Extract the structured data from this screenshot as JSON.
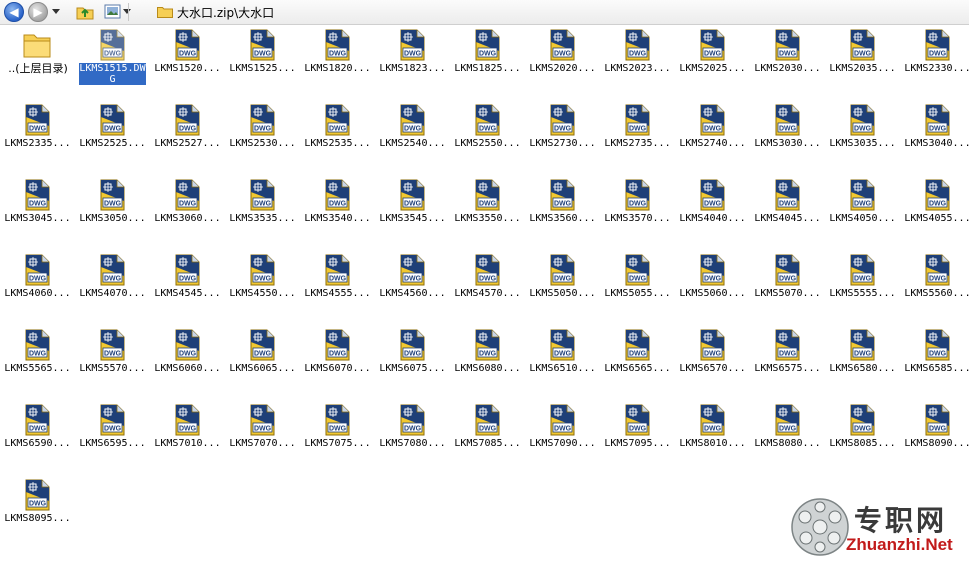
{
  "toolbar": {
    "address_text": "大水口.zip\\大水口",
    "back_glyph": "◀",
    "forward_glyph": "▶"
  },
  "icons": {
    "file_badge": "DWG"
  },
  "items": [
    {
      "label": "..(上层目录)",
      "kind": "up"
    },
    {
      "label": "LKMS1515.DWG",
      "kind": "dwg",
      "selected": true
    },
    {
      "label": "LKMS1520...",
      "kind": "dwg"
    },
    {
      "label": "LKMS1525...",
      "kind": "dwg"
    },
    {
      "label": "LKMS1820...",
      "kind": "dwg"
    },
    {
      "label": "LKMS1823...",
      "kind": "dwg"
    },
    {
      "label": "LKMS1825...",
      "kind": "dwg"
    },
    {
      "label": "LKMS2020...",
      "kind": "dwg"
    },
    {
      "label": "LKMS2023...",
      "kind": "dwg"
    },
    {
      "label": "LKMS2025...",
      "kind": "dwg"
    },
    {
      "label": "LKMS2030...",
      "kind": "dwg"
    },
    {
      "label": "LKMS2035...",
      "kind": "dwg"
    },
    {
      "label": "LKMS2330...",
      "kind": "dwg"
    },
    {
      "label": "LKMS2335...",
      "kind": "dwg"
    },
    {
      "label": "LKMS2525...",
      "kind": "dwg"
    },
    {
      "label": "LKMS2527...",
      "kind": "dwg"
    },
    {
      "label": "LKMS2530...",
      "kind": "dwg"
    },
    {
      "label": "LKMS2535...",
      "kind": "dwg"
    },
    {
      "label": "LKMS2540...",
      "kind": "dwg"
    },
    {
      "label": "LKMS2550...",
      "kind": "dwg"
    },
    {
      "label": "LKMS2730...",
      "kind": "dwg"
    },
    {
      "label": "LKMS2735...",
      "kind": "dwg"
    },
    {
      "label": "LKMS2740...",
      "kind": "dwg"
    },
    {
      "label": "LKMS3030...",
      "kind": "dwg"
    },
    {
      "label": "LKMS3035...",
      "kind": "dwg"
    },
    {
      "label": "LKMS3040...",
      "kind": "dwg"
    },
    {
      "label": "LKMS3045...",
      "kind": "dwg"
    },
    {
      "label": "LKMS3050...",
      "kind": "dwg"
    },
    {
      "label": "LKMS3060...",
      "kind": "dwg"
    },
    {
      "label": "LKMS3535...",
      "kind": "dwg"
    },
    {
      "label": "LKMS3540...",
      "kind": "dwg"
    },
    {
      "label": "LKMS3545...",
      "kind": "dwg"
    },
    {
      "label": "LKMS3550...",
      "kind": "dwg"
    },
    {
      "label": "LKMS3560...",
      "kind": "dwg"
    },
    {
      "label": "LKMS3570...",
      "kind": "dwg"
    },
    {
      "label": "LKMS4040...",
      "kind": "dwg"
    },
    {
      "label": "LKMS4045...",
      "kind": "dwg"
    },
    {
      "label": "LKMS4050...",
      "kind": "dwg"
    },
    {
      "label": "LKMS4055...",
      "kind": "dwg"
    },
    {
      "label": "LKMS4060...",
      "kind": "dwg"
    },
    {
      "label": "LKMS4070...",
      "kind": "dwg"
    },
    {
      "label": "LKMS4545...",
      "kind": "dwg"
    },
    {
      "label": "LKMS4550...",
      "kind": "dwg"
    },
    {
      "label": "LKMS4555...",
      "kind": "dwg"
    },
    {
      "label": "LKMS4560...",
      "kind": "dwg"
    },
    {
      "label": "LKMS4570...",
      "kind": "dwg"
    },
    {
      "label": "LKMS5050...",
      "kind": "dwg"
    },
    {
      "label": "LKMS5055...",
      "kind": "dwg"
    },
    {
      "label": "LKMS5060...",
      "kind": "dwg"
    },
    {
      "label": "LKMS5070...",
      "kind": "dwg"
    },
    {
      "label": "LKMS5555...",
      "kind": "dwg"
    },
    {
      "label": "LKMS5560...",
      "kind": "dwg"
    },
    {
      "label": "LKMS5565...",
      "kind": "dwg"
    },
    {
      "label": "LKMS5570...",
      "kind": "dwg"
    },
    {
      "label": "LKMS6060...",
      "kind": "dwg"
    },
    {
      "label": "LKMS6065...",
      "kind": "dwg"
    },
    {
      "label": "LKMS6070...",
      "kind": "dwg"
    },
    {
      "label": "LKMS6075...",
      "kind": "dwg"
    },
    {
      "label": "LKMS6080...",
      "kind": "dwg"
    },
    {
      "label": "LKMS6510...",
      "kind": "dwg"
    },
    {
      "label": "LKMS6565...",
      "kind": "dwg"
    },
    {
      "label": "LKMS6570...",
      "kind": "dwg"
    },
    {
      "label": "LKMS6575...",
      "kind": "dwg"
    },
    {
      "label": "LKMS6580...",
      "kind": "dwg"
    },
    {
      "label": "LKMS6585...",
      "kind": "dwg"
    },
    {
      "label": "LKMS6590...",
      "kind": "dwg"
    },
    {
      "label": "LKMS6595...",
      "kind": "dwg"
    },
    {
      "label": "LKMS7010...",
      "kind": "dwg"
    },
    {
      "label": "LKMS7070...",
      "kind": "dwg"
    },
    {
      "label": "LKMS7075...",
      "kind": "dwg"
    },
    {
      "label": "LKMS7080...",
      "kind": "dwg"
    },
    {
      "label": "LKMS7085...",
      "kind": "dwg"
    },
    {
      "label": "LKMS7090...",
      "kind": "dwg"
    },
    {
      "label": "LKMS7095...",
      "kind": "dwg"
    },
    {
      "label": "LKMS8010...",
      "kind": "dwg"
    },
    {
      "label": "LKMS8080...",
      "kind": "dwg"
    },
    {
      "label": "LKMS8085...",
      "kind": "dwg"
    },
    {
      "label": "LKMS8090...",
      "kind": "dwg"
    },
    {
      "label": "LKMS8095...",
      "kind": "dwg"
    }
  ],
  "watermark": {
    "cn_text": "专职网",
    "en_text": "Zhuanzhi.Net"
  },
  "colors": {
    "selection": "#316ac5",
    "dwg_yellow": "#f2c830",
    "dwg_navy": "#1e3f78",
    "folder": "#f6cf55",
    "watermark_red": "#c21b1b"
  }
}
